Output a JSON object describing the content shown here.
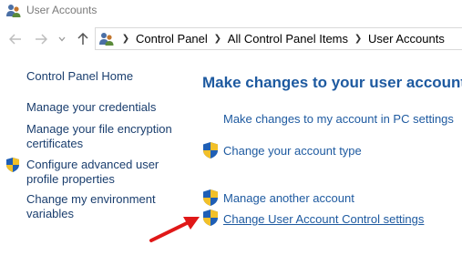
{
  "window": {
    "title": "User Accounts",
    "title_icon": "users-icon"
  },
  "nav": {
    "back_icon": "arrow-left-icon",
    "forward_icon": "arrow-right-icon",
    "recent_icon": "chevron-down-icon",
    "up_icon": "arrow-up-icon"
  },
  "address": {
    "icon": "users-icon",
    "crumbs": [
      "Control Panel",
      "All Control Panel Items",
      "User Accounts"
    ]
  },
  "sidebar": {
    "home": "Control Panel Home",
    "credentials": "Manage your credentials",
    "encryption_line1": "Manage your file encryption",
    "encryption_line2": "certificates",
    "profile_line1": "Configure advanced user",
    "profile_line2": "profile properties",
    "environment_line1": "Change my environment",
    "environment_line2": "variables"
  },
  "main": {
    "title": "Make changes to your user account",
    "pc_settings": "Make changes to my account in PC settings",
    "account_type": "Change your account type",
    "manage_another": "Manage another account",
    "uac_settings": "Change User Account Control settings"
  },
  "colors": {
    "link": "#1e5aa0",
    "sidebar_link": "#1a3e6e",
    "arrow": "#e01818",
    "shield_blue": "#1f5fb5",
    "shield_yellow": "#f2c029"
  }
}
